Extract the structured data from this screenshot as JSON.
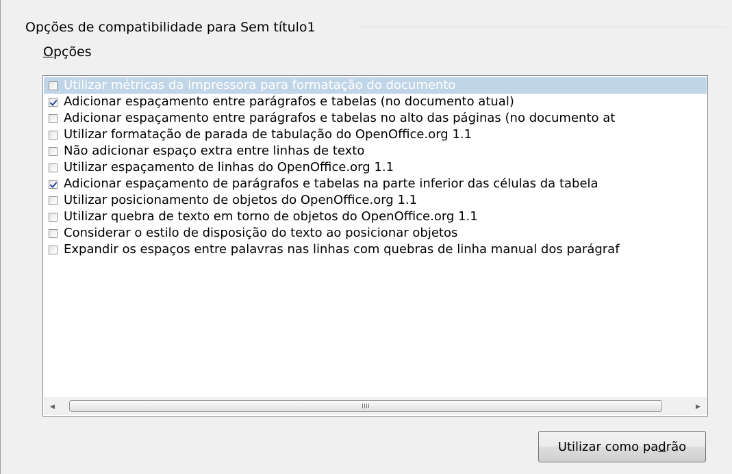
{
  "group": {
    "title": "Opções de compatibilidade para Sem título1"
  },
  "options_label": {
    "mnemonic": "O",
    "rest": "pções"
  },
  "options": [
    {
      "label": "Utilizar métricas da impressora para formatação do documento",
      "checked": false,
      "selected": true
    },
    {
      "label": "Adicionar espaçamento entre parágrafos e tabelas (no documento atual)",
      "checked": true,
      "selected": false
    },
    {
      "label": "Adicionar espaçamento entre parágrafos e tabelas no alto das páginas (no documento at",
      "checked": false,
      "selected": false
    },
    {
      "label": "Utilizar formatação de parada de tabulação do OpenOffice.org 1.1",
      "checked": false,
      "selected": false
    },
    {
      "label": "Não adicionar espaço extra entre linhas de texto",
      "checked": false,
      "selected": false
    },
    {
      "label": "Utilizar espaçamento de linhas do OpenOffice.org 1.1",
      "checked": false,
      "selected": false
    },
    {
      "label": "Adicionar espaçamento de parágrafos e tabelas na parte inferior das células da tabela",
      "checked": true,
      "selected": false
    },
    {
      "label": "Utilizar posicionamento de objetos do OpenOffice.org 1.1",
      "checked": false,
      "selected": false
    },
    {
      "label": "Utilizar quebra de texto em torno de objetos do OpenOffice.org 1.1",
      "checked": false,
      "selected": false
    },
    {
      "label": "Considerar o estilo de disposição do texto ao posicionar objetos",
      "checked": false,
      "selected": false
    },
    {
      "label": "Expandir os espaços entre palavras nas linhas com quebras de linha manual dos parágraf",
      "checked": false,
      "selected": false
    }
  ],
  "scrollbar": {
    "left_icon": "arrow-left-icon",
    "right_icon": "arrow-right-icon",
    "grip_icon": "grip-icon"
  },
  "button": {
    "label_pre": "Utilizar como pa",
    "label_mnemonic": "d",
    "label_post": "rão"
  },
  "colors": {
    "selection": "#c1d5e8",
    "checkmark": "#22449e",
    "list_border": "#828790",
    "background": "#f0f0f0"
  }
}
